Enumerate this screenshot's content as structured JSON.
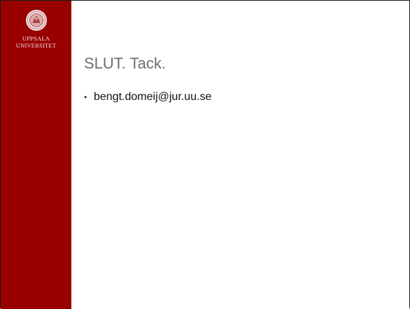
{
  "sidebar": {
    "logo_icon": "uppsala-university-seal-icon",
    "name_line1": "UPPSALA",
    "name_line2": "UNIVERSITET",
    "color": "#990000"
  },
  "slide": {
    "title": "SLUT. Tack.",
    "bullets": [
      {
        "mark": "•",
        "text": "bengt.domeij@jur.uu.se"
      }
    ]
  }
}
